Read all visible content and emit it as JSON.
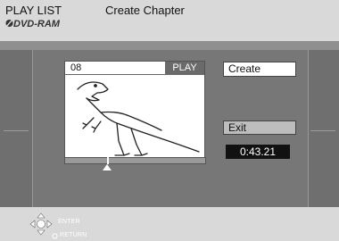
{
  "header": {
    "title": "PLAY LIST",
    "subtitle": "Create Chapter",
    "disc_label": "DVD-RAM"
  },
  "preview": {
    "chapter_number": "08",
    "status": "PLAY",
    "progress": 0.3
  },
  "buttons": {
    "create_label": "Create",
    "exit_label": "Exit"
  },
  "time_display": "0:43.21",
  "footer": {
    "enter_label": "ENTER",
    "return_label": "RETURN"
  },
  "colors": {
    "background_light": "#d9d9d9",
    "panel": "#777777",
    "selected_button": "#ffffff",
    "time_bg": "#111111"
  }
}
